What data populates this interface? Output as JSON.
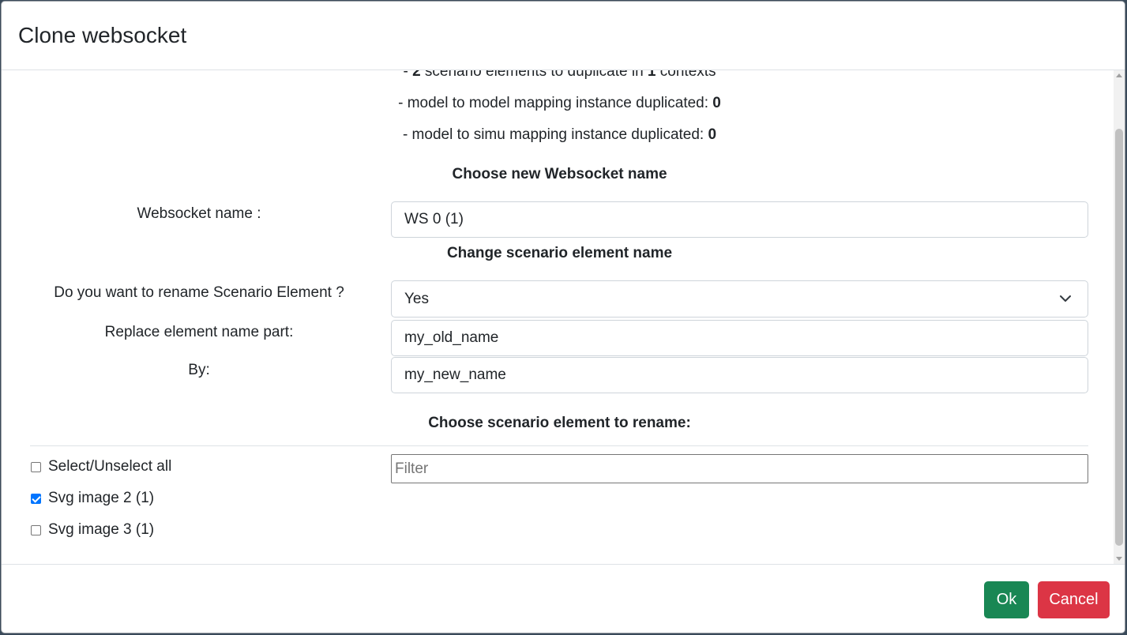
{
  "modal": {
    "title": "Clone websocket"
  },
  "summary": {
    "line1_prefix": "- ",
    "line1_count": "2",
    "line1_mid": " scenario elements to duplicate in ",
    "line1_contexts": "1",
    "line1_suffix": " contexts",
    "line2_text": "- model to model mapping instance duplicated: ",
    "line2_value": "0",
    "line3_text": "- model to simu mapping instance duplicated: ",
    "line3_value": "0"
  },
  "websocket_section": {
    "title": "Choose new Websocket name",
    "name_label": "Websocket name :",
    "name_value": "WS 0 (1)"
  },
  "rename_section": {
    "title": "Change scenario element name",
    "question_label": "Do you want to rename Scenario Element ?",
    "question_value": "Yes",
    "replace_label": "Replace element name part:",
    "replace_value": "my_old_name",
    "by_label": "By:",
    "by_value": "my_new_name"
  },
  "elements_section": {
    "title": "Choose scenario element to rename:",
    "filter_placeholder": "Filter",
    "select_all_label": "Select/Unselect all",
    "select_all_checked": false,
    "items": [
      {
        "label": "Svg image 2 (1)",
        "checked": true
      },
      {
        "label": "Svg image 3 (1)",
        "checked": false
      }
    ]
  },
  "footer": {
    "ok_label": "Ok",
    "cancel_label": "Cancel"
  },
  "colors": {
    "ok_button": "#198754",
    "cancel_button": "#dc3545",
    "checkbox_checked": "#0075ff"
  }
}
